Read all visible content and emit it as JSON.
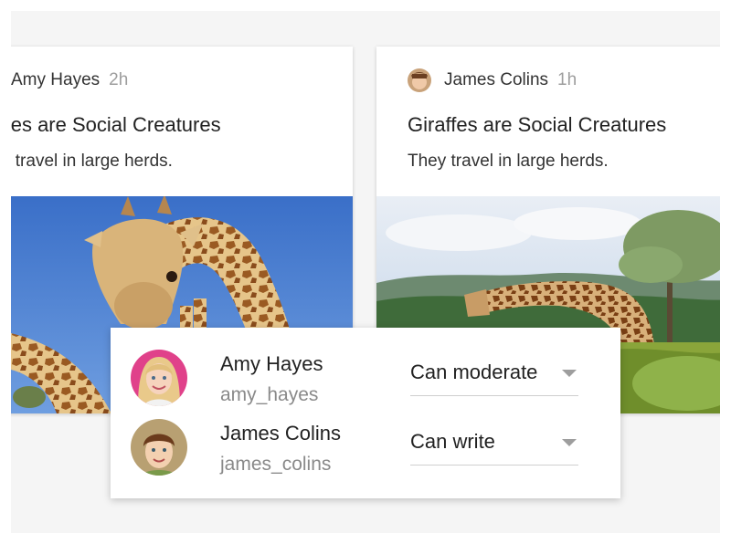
{
  "cards": [
    {
      "author": "Amy Hayes",
      "time": "2h",
      "title": "iffes are Social Creatures",
      "subtitle": "y travel in large herds."
    },
    {
      "author": "James Colins",
      "time": "1h",
      "title": "Giraffes are Social Creatures",
      "subtitle": "They travel in large herds."
    }
  ],
  "share_panel": {
    "members": [
      {
        "name": "Amy Hayes",
        "username": "amy_hayes",
        "permission": "Can moderate"
      },
      {
        "name": "James Colins",
        "username": "james_colins",
        "permission": "Can write"
      }
    ]
  },
  "colors": {
    "card_background": "#ffffff",
    "page_background": "#f5f5f5",
    "muted_text": "#9e9e9e"
  }
}
